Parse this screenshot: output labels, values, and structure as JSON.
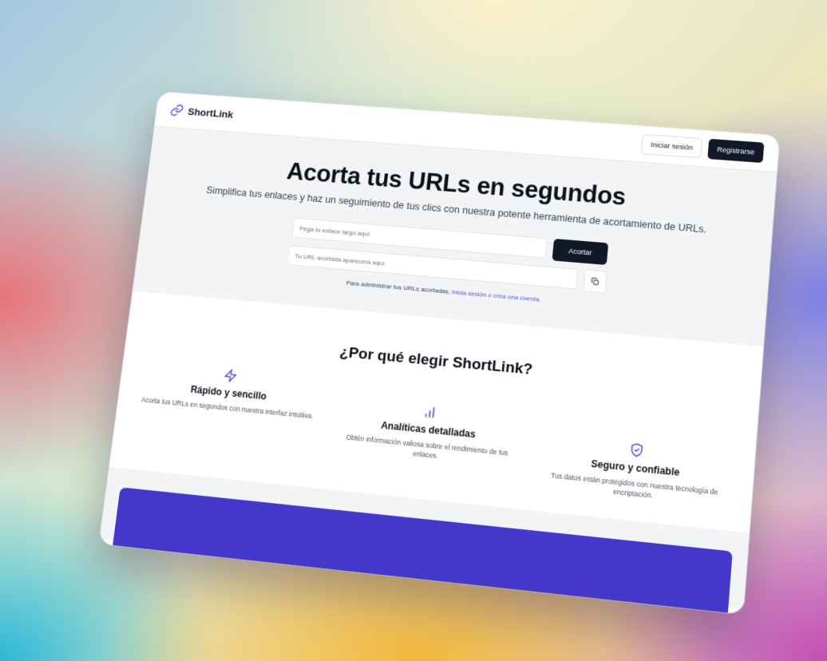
{
  "header": {
    "brand": "ShortLink",
    "login_label": "Iniciar sesión",
    "register_label": "Registrarse"
  },
  "hero": {
    "title": "Acorta tus URLs en segundos",
    "subtitle": "Simplifica tus enlaces y haz un seguimiento de tus clics con nuestra potente herramienta de acortamiento de URLs.",
    "long_url_placeholder": "Pega tu enlace largo aquí",
    "short_url_placeholder": "Tu URL acortada aparecerá aquí",
    "shorten_label": "Acortar",
    "hint_text": "Para administrar tus URLs acortadas,",
    "hint_link": "inicia sesión o crea una cuenta."
  },
  "features": {
    "title": "¿Por qué elegir ShortLink?",
    "items": [
      {
        "icon": "zap-icon",
        "title": "Rápido y sencillo",
        "text": "Acorta tus URLs en segundos con nuestra interfaz intuitiva."
      },
      {
        "icon": "bar-chart-icon",
        "title": "Analíticas detalladas",
        "text": "Obtén información valiosa sobre el rendimiento de tus enlaces."
      },
      {
        "icon": "shield-check-icon",
        "title": "Seguro y confiable",
        "text": "Tus datos están protegidos con nuestra tecnología de encriptación."
      }
    ]
  },
  "colors": {
    "accent": "#5b4fe0",
    "cta": "#4338ca",
    "dark": "#111827"
  }
}
